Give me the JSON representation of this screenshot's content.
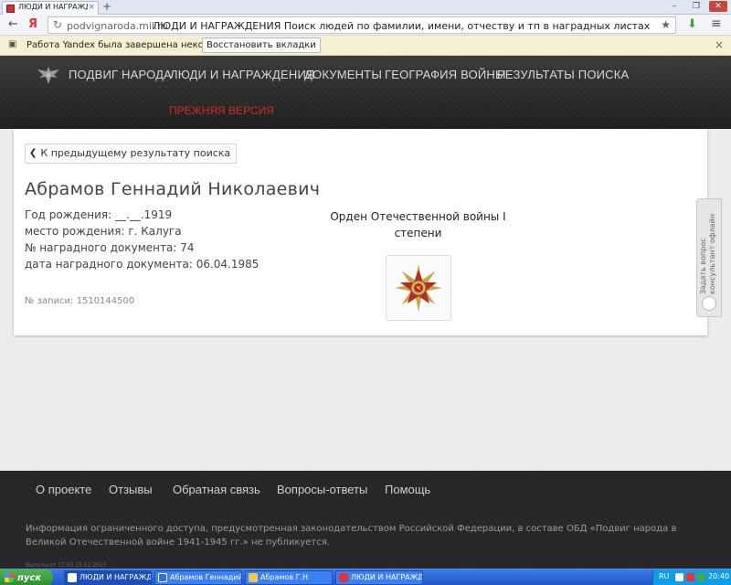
{
  "browser": {
    "tab_title": "ЛЮДИ И НАГРАЖДЕНИЯ",
    "tab_close": "×",
    "new_tab": "+",
    "window_buttons": [
      "–",
      "❐",
      "✕"
    ],
    "back": "←",
    "yandex": "Я",
    "address_domain": "podvignaroda.mil.ru",
    "address_title": "ЛЮДИ И НАГРАЖДЕНИЯ Поиск людей по фамилии, имени, отчеству и тп в наградных листах, приказах о награжд...",
    "star": "★",
    "download": "⬇",
    "menu": "≡"
  },
  "infobar": {
    "message": "Работа Yandex была завершена некорректно.",
    "restore_label": "Восстановить вкладки",
    "close": "×"
  },
  "header": {
    "nav": [
      "ПОДВИГ НАРОДА",
      "ЛЮДИ И НАГРАЖДЕНИЯ",
      "ДОКУМЕНТЫ",
      "ГЕОГРАФИЯ ВОЙНЫ",
      "РЕЗУЛЬТАТЫ ПОИСКА"
    ],
    "previous_version": "ПРЕЖНЯЯ ВЕРСИЯ",
    "colors": {
      "accent_red": "#d3261e",
      "nav_text": "#d8d8d8"
    }
  },
  "record": {
    "back_label": "К предыдущему результату поиска",
    "name": "Абрамов Геннадий Николаевич",
    "birth_year": "Год рождения: __.__.1919",
    "birth_place": "место рождения: г. Калуга",
    "doc_number": "№ наградного документа: 74",
    "doc_date": "дата наградного документа: 06.04.1985",
    "record_number": "№ записи: 1510144500",
    "award": "Орден Отечественной войны I степени"
  },
  "feedback": {
    "line1": "Задать вопрос",
    "line2": "консультант офлайн"
  },
  "footer": {
    "links": [
      "О проекте",
      "Отзывы",
      "Обратная связь",
      "Вопросы-ответы",
      "Помощь"
    ],
    "notice": "Информация ограниченного доступа, предусмотренная законодательством Российской Федерации, в составе ОБД «Подвиг народа в Великой Отечественной войне 1941-1945 гг.» не публикуется.",
    "small": "Выполн.от 17.03.15 12.2015"
  },
  "taskbar": {
    "start": "пуск",
    "items": [
      "ЛЮДИ И НАГРАЖДЕ...",
      "Абрамов Геннадий ...",
      "Абрамов Г.Н",
      "ЛЮДИ И НАГРАЖДЕ..."
    ],
    "lang": "RU",
    "clock": "20:40"
  }
}
